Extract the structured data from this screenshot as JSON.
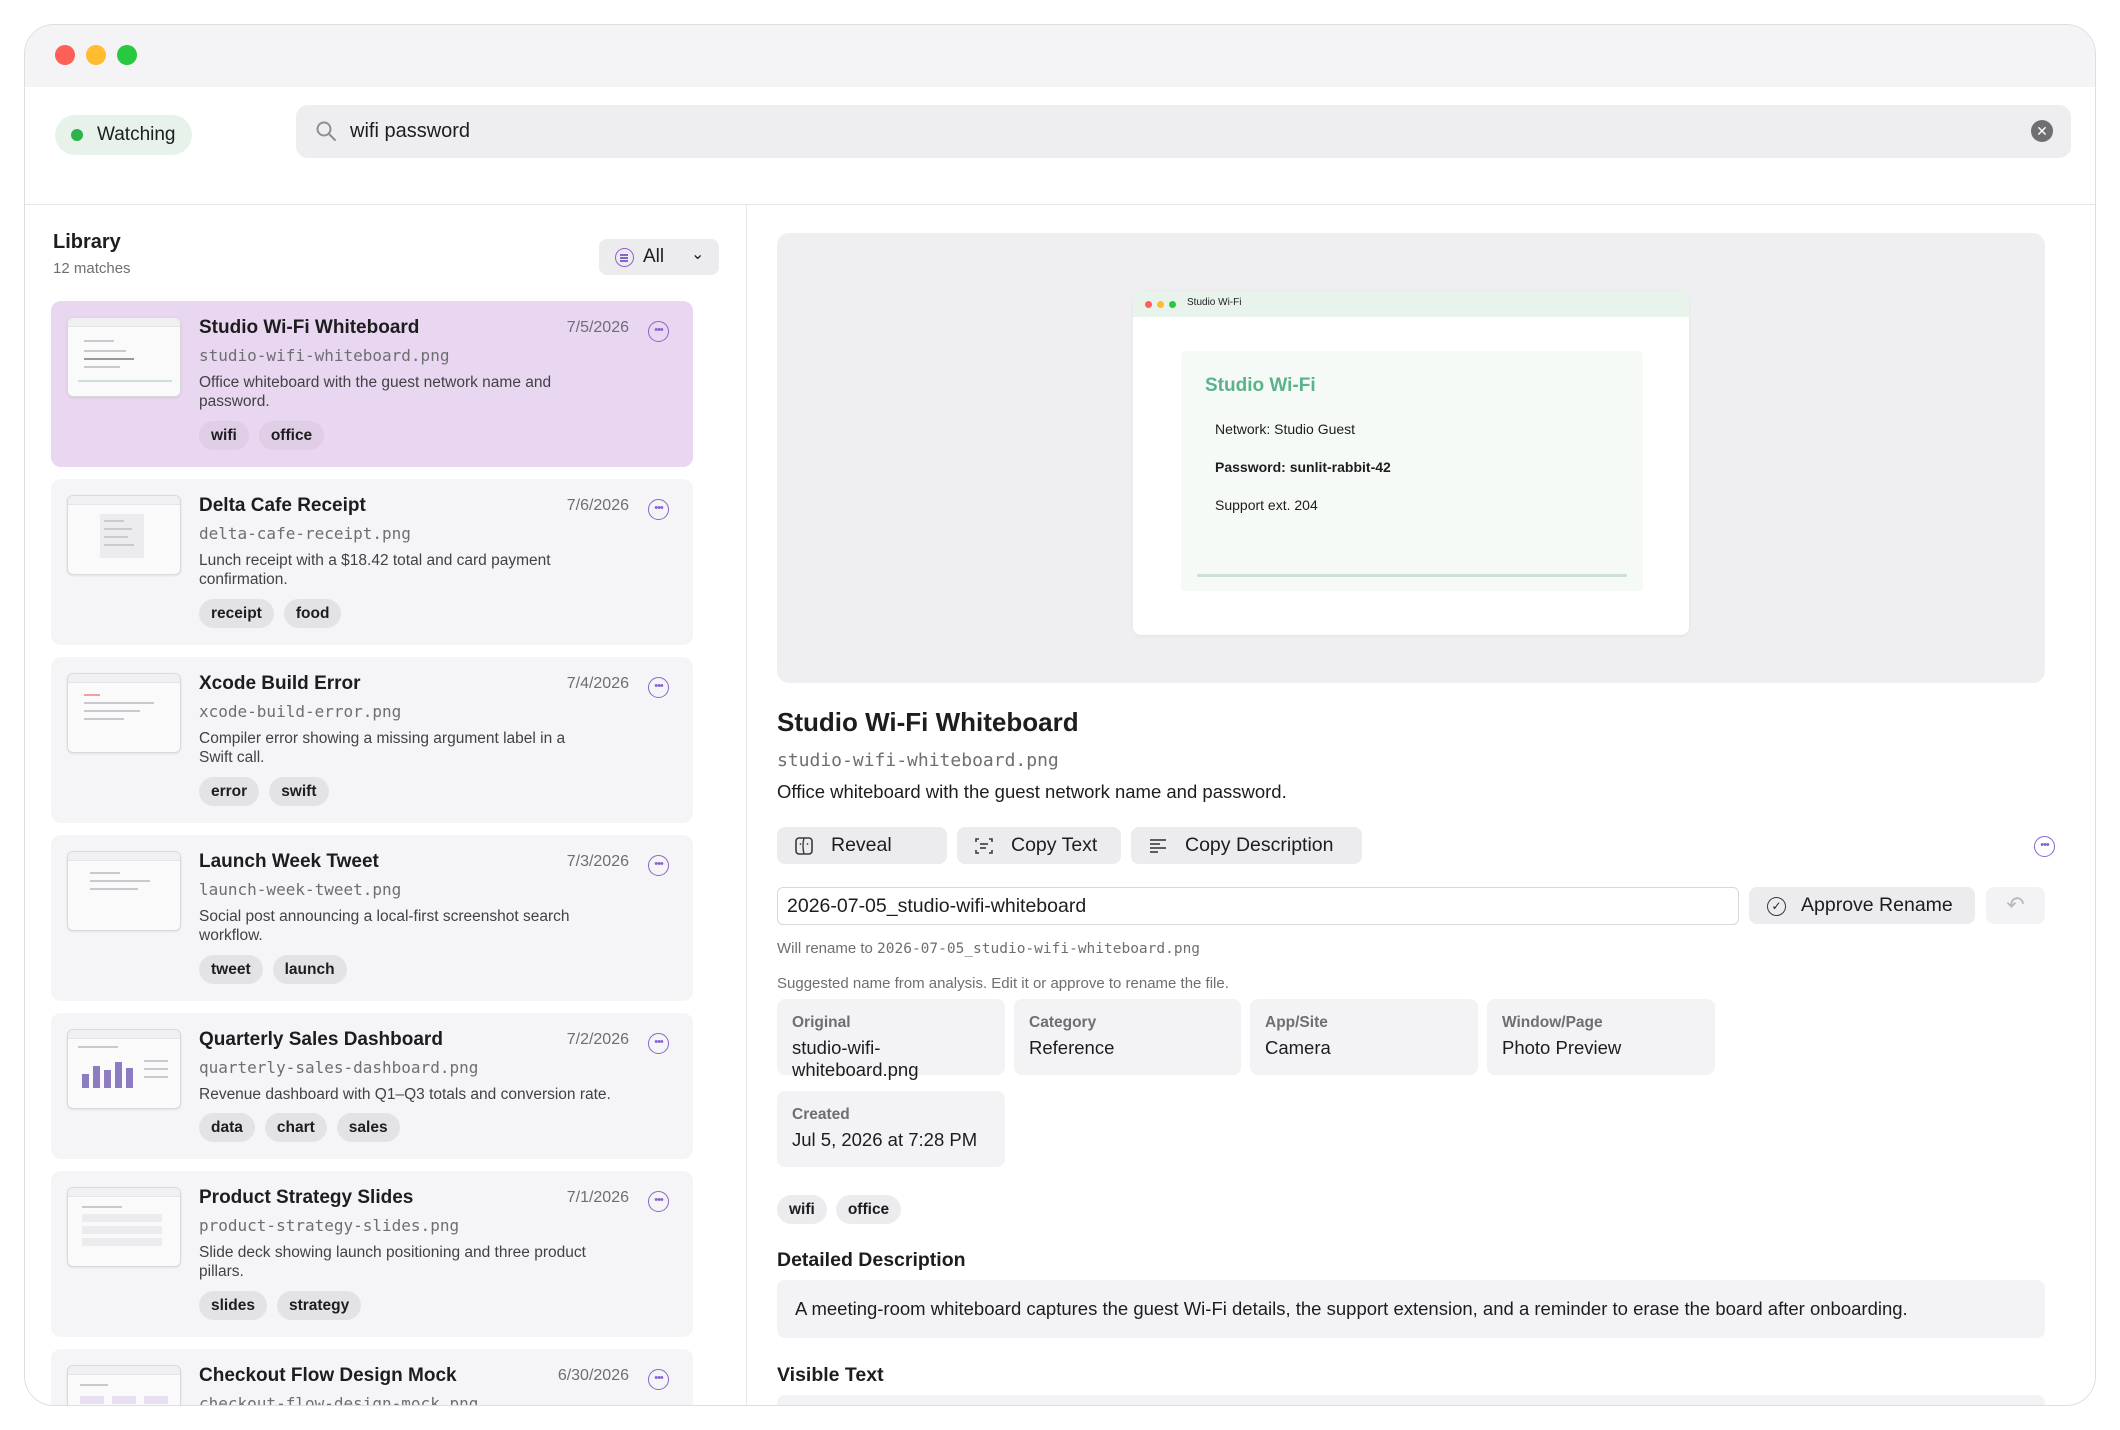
{
  "colors": {
    "accent": "#8a63d2",
    "selected_card": "#e9d6f0",
    "watching_green": "#2cb34a"
  },
  "toolbar": {
    "watching_label": "Watching",
    "search_value": "wifi password",
    "search_icon": "magnifier-icon",
    "clear_icon": "clear-circle-icon"
  },
  "library": {
    "title": "Library",
    "count": "12 matches",
    "filter_label": "All",
    "items": [
      {
        "title": "Studio Wi-Fi Whiteboard",
        "date": "7/5/2026",
        "file": "studio-wifi-whiteboard.png",
        "desc": "Office whiteboard with the guest network name and password.",
        "tags": [
          "wifi",
          "office"
        ],
        "selected": true
      },
      {
        "title": "Delta Cafe Receipt",
        "date": "7/6/2026",
        "file": "delta-cafe-receipt.png",
        "desc": "Lunch receipt with a $18.42 total and card payment confirmation.",
        "tags": [
          "receipt",
          "food"
        ]
      },
      {
        "title": "Xcode Build Error",
        "date": "7/4/2026",
        "file": "xcode-build-error.png",
        "desc": "Compiler error showing a missing argument label in a Swift call.",
        "tags": [
          "error",
          "swift"
        ]
      },
      {
        "title": "Launch Week Tweet",
        "date": "7/3/2026",
        "file": "launch-week-tweet.png",
        "desc": "Social post announcing a local-first screenshot search workflow.",
        "tags": [
          "tweet",
          "launch"
        ]
      },
      {
        "title": "Quarterly Sales Dashboard",
        "date": "7/2/2026",
        "file": "quarterly-sales-dashboard.png",
        "desc": "Revenue dashboard with Q1–Q3 totals and conversion rate.",
        "tags": [
          "data",
          "chart",
          "sales"
        ]
      },
      {
        "title": "Product Strategy Slides",
        "date": "7/1/2026",
        "file": "product-strategy-slides.png",
        "desc": "Slide deck showing launch positioning and three product pillars.",
        "tags": [
          "slides",
          "strategy"
        ]
      },
      {
        "title": "Checkout Flow Design Mock",
        "date": "6/30/2026",
        "file": "checkout-flow-design-mock.png",
        "desc": "",
        "tags": []
      }
    ]
  },
  "preview": {
    "window_title": "Studio Wi-Fi",
    "heading": "Studio Wi-Fi",
    "network_line": "Network: Studio Guest",
    "password_line": "Password: sunlit-rabbit-42",
    "support_line": "Support ext. 204"
  },
  "detail": {
    "title": "Studio Wi-Fi Whiteboard",
    "file": "studio-wifi-whiteboard.png",
    "desc": "Office whiteboard with the guest network name and password.",
    "reveal_label": "Reveal",
    "copy_text_label": "Copy Text",
    "copy_desc_label": "Copy Description",
    "rename_value": "2026-07-05_studio-wifi-whiteboard",
    "approve_label": "Approve Rename",
    "will_rename_prefix": "Will rename to",
    "will_rename_target": "2026-07-05_studio-wifi-whiteboard.png",
    "suggestion_note": "Suggested name from analysis. Edit it or approve to rename the file.",
    "meta": {
      "original_label": "Original",
      "original_value": "studio-wifi-whiteboard.png",
      "category_label": "Category",
      "category_value": "Reference",
      "app_label": "App/Site",
      "app_value": "Camera",
      "window_label": "Window/Page",
      "window_value": "Photo Preview",
      "created_label": "Created",
      "created_value": "Jul 5, 2026 at 7:28 PM"
    },
    "tags": [
      "wifi",
      "office"
    ],
    "detailed_heading": "Detailed Description",
    "detailed_text": "A meeting-room whiteboard captures the guest Wi-Fi details, the support extension, and a reminder to erase the board after onboarding.",
    "visible_text_heading": "Visible Text"
  }
}
